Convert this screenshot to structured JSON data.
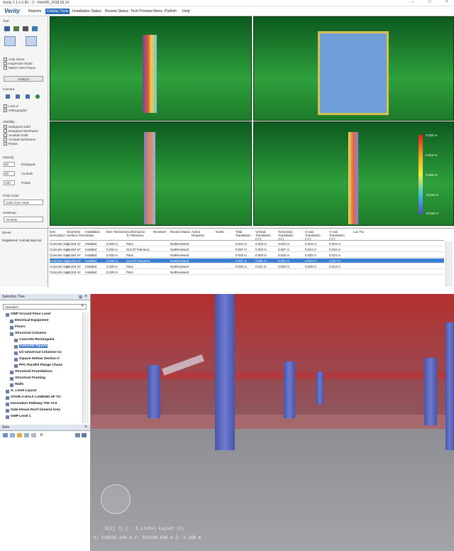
{
  "app": {
    "title": "Verity 1.1.1.0 B1 - 3 - Vrtx000_2018.03.14",
    "logo": "Verity",
    "window_controls": [
      "–",
      "□",
      "×"
    ]
  },
  "menu": [
    "Reports",
    "Display Tools",
    "Installation Status",
    "Review Status",
    "Tech Preview Menu",
    "Publish",
    "Help"
  ],
  "left_panel": {
    "tool_header": "Tool",
    "checkboxes1": [
      "Auto Zoom",
      "Inspection Mode",
      "Match View Frame"
    ],
    "analyze_button": "Analyze",
    "camera_header": "Camera",
    "camera_checks": [
      "Lock Z",
      "Orthographic"
    ],
    "visibility_header": "Visibility",
    "visibility_items": [
      "Designed Solid",
      "Designed Wireframe",
      "As-Built Solid",
      "As-Built Wireframe",
      "Points"
    ],
    "opacity_header": "Opacity",
    "opacity_rows": [
      {
        "value": "50",
        "label": "Designed"
      },
      {
        "value": "50",
        "label": "As-Built"
      },
      {
        "value": "100",
        "label": "Points"
      }
    ],
    "point_color_header": "Point Color",
    "point_color_value": "Color from Heat",
    "heatmap_header": "Heatmap",
    "heatmap_value": "As-Built"
  },
  "legend": {
    "labels": [
      "0.030 m",
      "0.015 m",
      "0.000 m",
      "-0.015 m",
      "-0.030 m"
    ]
  },
  "grid": {
    "side_header": "Scene",
    "side_text": "Registered / normal data set",
    "columns": [
      "Item Description",
      "Geometry Surface Area",
      "Installation Status",
      "Item Tolerance",
      "Conformance To Tolerance",
      "Reviewer",
      "Review Status",
      "Action Required",
      "Notes",
      "Total Translation",
      "Vertical Translation (+/-)",
      "Horizontal Translation (+/-)",
      "X Axis Translation (+/-)",
      "Y Axis Translation (+/-)",
      "Loc Tra"
    ],
    "rows": [
      [
        "Concrete Squ.",
        "13.464 m²",
        "Installed",
        "0.030 m",
        "Pass",
        "",
        "NotReviewed",
        "",
        "",
        "0.024 m",
        "0.003 m",
        "0.024 m",
        "0.023 m",
        "0.023 m"
      ],
      [
        "Concrete Squ.",
        "13.464 m²",
        "Installed",
        "0.030 m",
        "Out Of Tolerance",
        "",
        "NotReviewed",
        "",
        "",
        "0.057 m",
        "0.002 m",
        "0.057 m",
        "0.023 m",
        "0.033 m"
      ],
      [
        "Concrete Squ.",
        "13.464 m²",
        "Installed",
        "0.030 m",
        "Pass",
        "",
        "NotReviewed",
        "",
        "",
        "0.025 m",
        "0.003 m",
        "0.025 m",
        "0.020 m",
        "0.024 m"
      ],
      [
        "Concrete Squ.",
        "13.404 m²",
        "Installed",
        "0.030 m",
        "Out Of Tolerance",
        "",
        "NotReviewed",
        "",
        "",
        "0.037 m",
        "0.001 m",
        "0.037 m",
        "0.023 m",
        "0.037 m"
      ],
      [
        "Concrete Squ.",
        "13.404 m²",
        "Installed",
        "0.030 m",
        "Pass",
        "",
        "NotReviewed",
        "",
        "",
        "0.030 m",
        "0.011 m",
        "0.030 m",
        "0.025 m",
        "0.013 m"
      ],
      [
        "Concrete Squ.",
        "13.404 m²",
        "Installed",
        "0.030 m",
        "Pass",
        "",
        "NotReviewed",
        "",
        "",
        "",
        "",
        "",
        "",
        ""
      ]
    ],
    "selected_row": 3
  },
  "selection_tree": {
    "title": "Selection Tree",
    "dropdown": "Standard",
    "items": [
      {
        "text": "GMP Ground Floor Level",
        "indent": 1
      },
      {
        "text": "Electrical Equipment",
        "indent": 2
      },
      {
        "text": "Floors",
        "indent": 2
      },
      {
        "text": "Structural Columns",
        "indent": 2
      },
      {
        "text": "Concrete Rectangular",
        "indent": 3
      },
      {
        "text": "Concrete Square",
        "indent": 3
      },
      {
        "text": "UC-Universal Columns-Co",
        "indent": 3
      },
      {
        "text": "Square Hollow Section-C",
        "indent": 3
      },
      {
        "text": "PFC-Parallel Flange Chann",
        "indent": 3
      },
      {
        "text": "Structural Foundations",
        "indent": 2
      },
      {
        "text": "Structural Framing",
        "indent": 2
      },
      {
        "text": "Walls",
        "indent": 2
      },
      {
        "text": "G_Lintel Layout",
        "indent": 1
      },
      {
        "text": "STAIR A HALF LANDING 6F TO",
        "indent": 1
      },
      {
        "text": "Innovation Pathway T05 +0.0",
        "indent": 1
      },
      {
        "text": "Gate House Roof General Area",
        "indent": 1
      },
      {
        "text": "GMP Level 1",
        "indent": 1
      }
    ],
    "highlighted": 5
  },
  "sets": {
    "title": "Sets"
  },
  "viewport": {
    "hud_line1": "H[2] 7[-] : G_Lintel Layout (2)",
    "hud_line2": "X: 518695.146 m  Y: 329108.696 m  Z: 3.168 m"
  },
  "colors": {
    "accent": "#2f6fb7",
    "selection": "#3d7fd0",
    "viewport_green": "#2ea03b"
  }
}
